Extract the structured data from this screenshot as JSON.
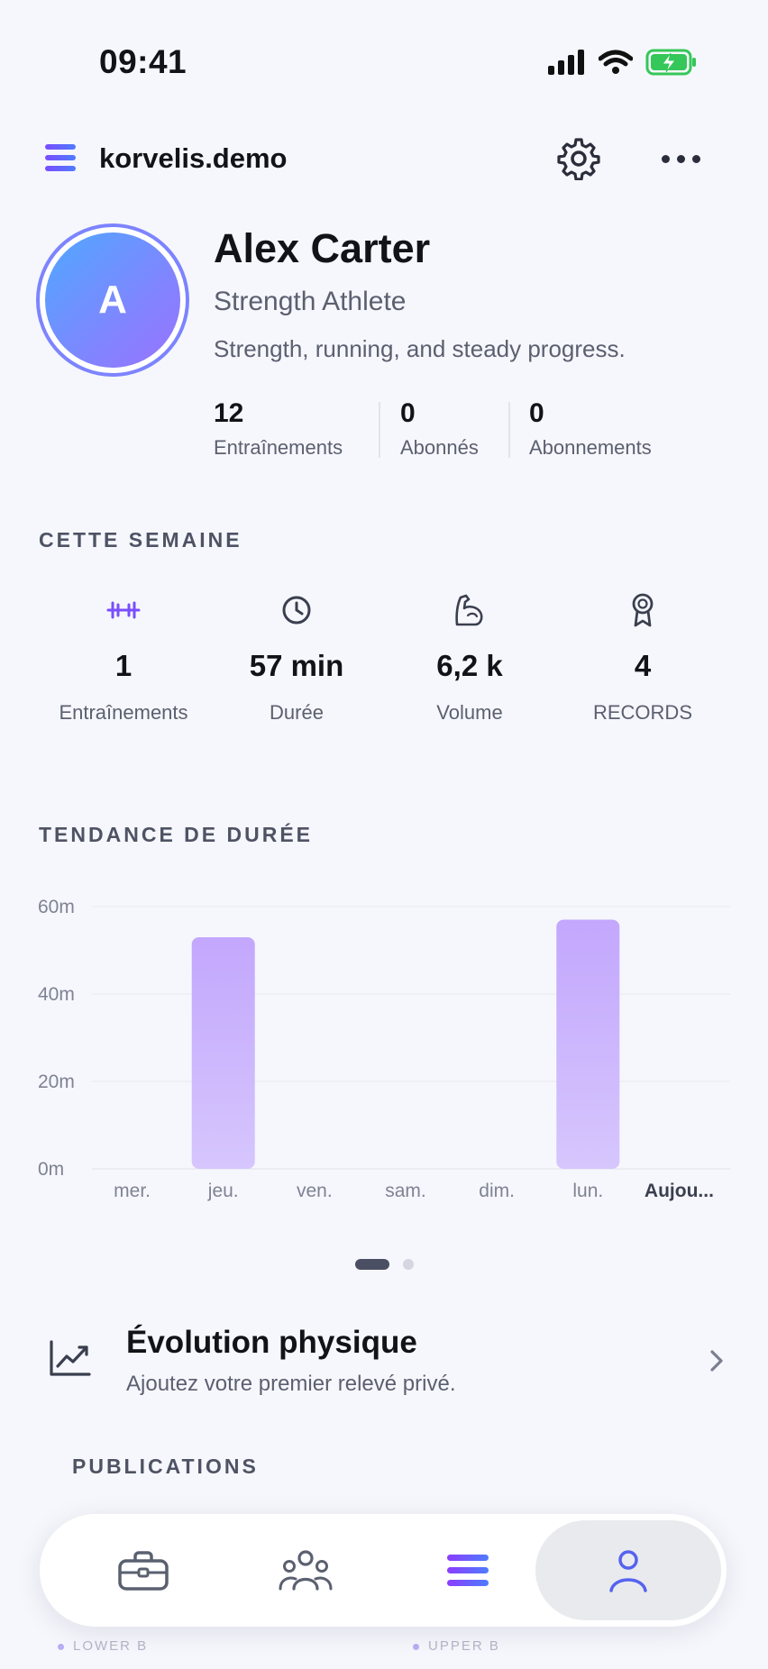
{
  "status_bar": {
    "time": "09:41"
  },
  "header": {
    "handle": "korvelis.demo"
  },
  "profile": {
    "initial": "A",
    "name": "Alex Carter",
    "role": "Strength Athlete",
    "bio": "Strength, running, and steady progress.",
    "stats": [
      {
        "value": "12",
        "label": "Entraînements"
      },
      {
        "value": "0",
        "label": "Abonnés"
      },
      {
        "value": "0",
        "label": "Abonnements"
      }
    ]
  },
  "this_week": {
    "title": "CETTE SEMAINE",
    "items": [
      {
        "icon": "dumbbell-icon",
        "value": "1",
        "label": "Entraînements"
      },
      {
        "icon": "clock-icon",
        "value": "57 min",
        "label": "Durée"
      },
      {
        "icon": "flexed-arm-icon",
        "value": "6,2 k",
        "label": "Volume"
      },
      {
        "icon": "medal-icon",
        "value": "4",
        "label": "RECORDS"
      }
    ]
  },
  "trend": {
    "title": "TENDANCE DE DURÉE"
  },
  "chart_data": {
    "type": "bar",
    "title": "TENDANCE DE DURÉE",
    "categories": [
      "mer.",
      "jeu.",
      "ven.",
      "sam.",
      "dim.",
      "lun.",
      "Aujou..."
    ],
    "values": [
      0,
      53,
      0,
      0,
      0,
      57,
      0
    ],
    "ylim": [
      0,
      60
    ],
    "y_ticks": [
      "0m",
      "20m",
      "40m",
      "60m"
    ],
    "grid": true,
    "bar_color": "#c3a7fd"
  },
  "evolution": {
    "title": "Évolution physique",
    "subtitle": "Ajoutez votre premier relevé privé."
  },
  "publications": {
    "title": "PUBLICATIONS"
  },
  "background_tags": [
    "LOWER B",
    "UPPER B"
  ],
  "tabbar": {
    "tabs": [
      {
        "name": "workouts",
        "icon": "briefcase-icon"
      },
      {
        "name": "community",
        "icon": "group-icon"
      },
      {
        "name": "feed",
        "icon": "menu-lines-icon"
      },
      {
        "name": "profile",
        "icon": "person-icon",
        "active": true
      }
    ]
  },
  "colors": {
    "accent": "#7a4dff",
    "accent_blue": "#4f7cff",
    "bar": "#c3a7fd",
    "battery": "#35c759"
  }
}
